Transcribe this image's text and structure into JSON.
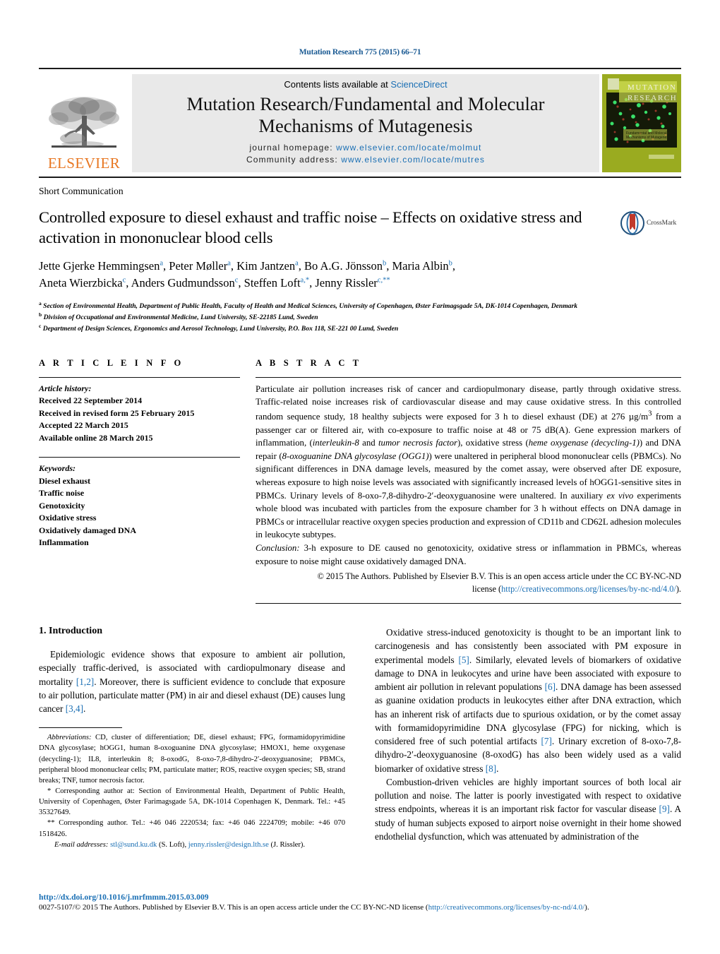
{
  "running_head": "Mutation Research 775 (2015) 66–71",
  "masthead": {
    "publisher_name": "ELSEVIER",
    "contents_prefix": "Contents lists available at ",
    "contents_link": "ScienceDirect",
    "journal_title_line1": "Mutation Research/Fundamental and Molecular",
    "journal_title_line2": "Mechanisms of Mutagenesis",
    "homepage_label": "journal homepage:",
    "homepage_url": "www.elsevier.com/locate/molmut",
    "community_label": "Community address:",
    "community_url": "www.elsevier.com/locate/mutres",
    "cover_title_line1": "MUTATION",
    "cover_title_line2": "RESEARCH",
    "cover_sub_line1": "Fundamental and Molecular",
    "cover_sub_line2": "Mechanisms of Mutagenesis"
  },
  "article": {
    "type_label": "Short Communication",
    "title": "Controlled exposure to diesel exhaust and traffic noise – Effects on oxidative stress and activation in mononuclear blood cells",
    "crossmark_label": "CrossMark",
    "authors_line1_parts": [
      {
        "t": "Jette Gjerke Hemmingsen",
        "s": "a"
      },
      {
        "t": ", Peter Møller",
        "s": "a"
      },
      {
        "t": ", Kim Jantzen",
        "s": "a"
      },
      {
        "t": ", Bo A.G. Jönsson",
        "s": "b"
      },
      {
        "t": ", Maria Albin",
        "s": "b"
      },
      {
        "t": ",",
        "s": ""
      }
    ],
    "authors_line2_parts": [
      {
        "t": "Aneta Wierzbicka",
        "s": "c"
      },
      {
        "t": ", Anders Gudmundsson",
        "s": "c"
      },
      {
        "t": ", Steffen Loft",
        "s": "a,*"
      },
      {
        "t": ", Jenny Rissler",
        "s": "c,**"
      }
    ],
    "affiliations": [
      {
        "mark": "a",
        "text": "Section of Environmental Health, Department of Public Health, Faculty of Health and Medical Sciences, University of Copenhagen, Øster Farimagsgade 5A, DK-1014 Copenhagen, Denmark"
      },
      {
        "mark": "b",
        "text": "Division of Occupational and Environmental Medicine, Lund University, SE-22185 Lund, Sweden"
      },
      {
        "mark": "c",
        "text": "Department of Design Sciences, Ergonomics and Aerosol Technology, Lund University, P.O. Box 118, SE-221 00 Lund, Sweden"
      }
    ]
  },
  "article_info": {
    "heading": "A R T I C L E   I N F O",
    "history_label": "Article history:",
    "history": [
      "Received 22 September 2014",
      "Received in revised form 25 February 2015",
      "Accepted 22 March 2015",
      "Available online 28 March 2015"
    ],
    "keywords_label": "Keywords:",
    "keywords": [
      "Diesel exhaust",
      "Traffic noise",
      "Genotoxicity",
      "Oxidative stress",
      "Oxidatively damaged DNA",
      "Inflammation"
    ]
  },
  "abstract": {
    "heading": "A B S T R A C T",
    "copyright_line1": "© 2015 The Authors. Published by Elsevier B.V. This is an open access article under the CC BY-NC-ND",
    "copyright_line2_prefix": "license (",
    "copyright_license_url": "http://creativecommons.org/licenses/by-nc-nd/4.0/",
    "copyright_line2_suffix": ")."
  },
  "introduction": {
    "heading": "1.  Introduction",
    "left_paragraph": "Epidemiologic evidence shows that exposure to ambient air pollution, especially traffic-derived, is associated with cardiopulmonary disease and mortality [1,2]. Moreover, there is sufficient evidence to conclude that exposure to air pollution, particulate matter (PM) in air and diesel exhaust (DE) causes lung cancer [3,4]."
  },
  "footnotes": {
    "abbrev_label": "Abbreviations:",
    "abbrev_text": " CD, cluster of differentiation; DE, diesel exhaust; FPG, formamidopyrimidine DNA glycosylase; hOGG1, human 8-oxoguanine DNA glycosylase; HMOX1, heme oxygenase (decycling-1); IL8, interleukin 8; 8-oxodG, 8-oxo-7,8-dihydro-2′-deoxyguanosine; PBMCs, peripheral blood mononuclear cells; PM, particulate matter; ROS, reactive oxygen species; SB, strand breaks; TNF, tumor necrosis factor.",
    "corr1": "* Corresponding author at: Section of Environmental Health, Department of Public Health, University of Copenhagen, Øster Farimagsgade 5A, DK-1014 Copenhagen K, Denmark. Tel.: +45 35327649.",
    "corr2": "** Corresponding author. Tel.: +46 046 2220534; fax: +46 046 2224709; mobile: +46 070 1518426.",
    "email_label": "E-mail addresses:",
    "email1": "stl@sund.ku.dk",
    "email1_owner": " (S. Loft), ",
    "email2": "jenny.rissler@design.lth.se",
    "email2_owner": " (J. Rissler)."
  },
  "page_footer": {
    "doi": "http://dx.doi.org/10.1016/j.mrfmmm.2015.03.009",
    "issn_text_before": "0027-5107/© 2015 The Authors. Published by Elsevier B.V. This is an open access article under the CC BY-NC-ND license (",
    "issn_license_url": "http://creativecommons.org/licenses/by-nc-nd/4.0/",
    "issn_text_after": ")."
  },
  "colors": {
    "link_blue": "#1a6fb4",
    "running_head_blue": "#1a5a93",
    "elsevier_orange": "#e87722",
    "masthead_grey": "#e9e9e9",
    "cover_olive": "#9aab20"
  }
}
